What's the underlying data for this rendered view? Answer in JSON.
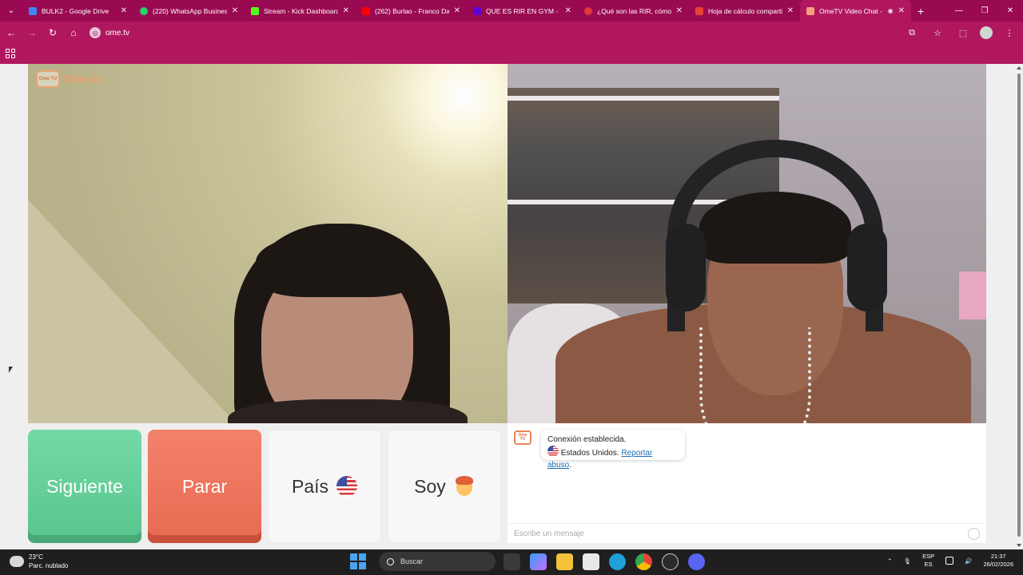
{
  "browser": {
    "tabs": [
      {
        "title": "BULK2 - Google Drive",
        "color": "#4285f4"
      },
      {
        "title": "(220) WhatsApp Business",
        "color": "#25d366"
      },
      {
        "title": "Stream - Kick Dashboard",
        "color": "#53fc18"
      },
      {
        "title": "(262) Burlao - Franco Dan",
        "color": "#ff0000"
      },
      {
        "title": "QUE ES RIR EN GYM - Yah",
        "color": "#6001d2"
      },
      {
        "title": "¿Qué son las RIR, cómo in",
        "color": "#e03a3a"
      },
      {
        "title": "Hoja de cálculo comparti",
        "color": "#ea4335"
      },
      {
        "title": "OmeTV Video Chat -",
        "color": "#f59f7a"
      }
    ],
    "url": "ome.tv"
  },
  "site": {
    "logo_tv": "Ome TV",
    "logo_text": "Ome.tv"
  },
  "controls": {
    "next_label": "Siguiente",
    "stop_label": "Parar",
    "country_label": "País",
    "gender_label": "Soy"
  },
  "chat": {
    "message_line1": "Conexión establecida.",
    "message_country": "Estados Unidos.",
    "report_link": "Reportar abuso",
    "input_placeholder": "Escribe un mensaje"
  },
  "taskbar": {
    "temperature": "23°C",
    "weather": "Parc. nublado",
    "search": "Buscar",
    "lang_top": "ESP",
    "lang_bottom": "ES",
    "time": "21:37",
    "date": "26/02/2026"
  },
  "colors": {
    "browser_frame": "#b0175f",
    "next_button": "#5fcb94",
    "stop_button": "#ec7259"
  }
}
